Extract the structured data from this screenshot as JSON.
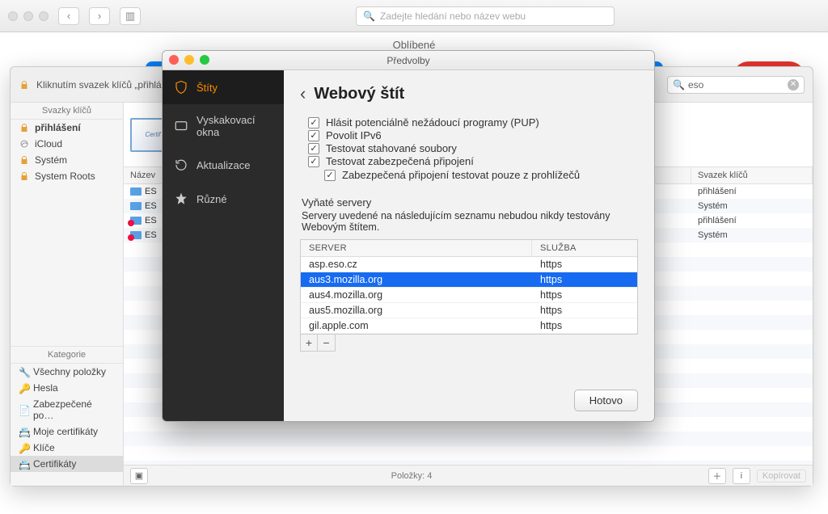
{
  "browser": {
    "search_placeholder": "Zadejte hledání nebo název webu",
    "favorites_label": "Oblíbené"
  },
  "keychain": {
    "title_prefix": "Kliknutím svazek klíčů „přihláš",
    "search_value": "eso",
    "side_header": "Svazky klíčů",
    "chains": [
      {
        "label": "přihlášení",
        "bold": true
      },
      {
        "label": "iCloud"
      },
      {
        "label": "Systém"
      },
      {
        "label": "System Roots"
      }
    ],
    "categories_header": "Kategorie",
    "categories": [
      "Všechny položky",
      "Hesla",
      "Zabezpečené po…",
      "Moje certifikáty",
      "Klíče",
      "Certifikáty"
    ],
    "selected_category_index": 5,
    "table_headers": {
      "name": "Název",
      "chain": "Svazek klíčů"
    },
    "rows": [
      {
        "name": "ES",
        "chain": "přihlášení",
        "err": false
      },
      {
        "name": "ES",
        "chain": "Systém",
        "err": false
      },
      {
        "name": "ES",
        "chain": "přihlášení",
        "err": true
      },
      {
        "name": "ES",
        "chain": "Systém",
        "err": true
      }
    ],
    "footer_count": "Položky: 4",
    "copy_label": "Kopírovat"
  },
  "prefs": {
    "window_title": "Předvolby",
    "sidebar": [
      {
        "key": "shields",
        "label": "Štíty"
      },
      {
        "key": "popups",
        "label": "Vyskakovací okna"
      },
      {
        "key": "updates",
        "label": "Aktualizace"
      },
      {
        "key": "misc",
        "label": "Různé"
      }
    ],
    "active_sidebar_index": 0,
    "page_title": "Webový štít",
    "checks": [
      {
        "label": "Hlásit potenciálně nežádoucí programy (PUP)",
        "checked": true
      },
      {
        "label": "Povolit IPv6",
        "checked": true
      },
      {
        "label": "Testovat stahované soubory",
        "checked": true
      },
      {
        "label": "Testovat zabezpečená připojení",
        "checked": true
      }
    ],
    "sub_check": {
      "label": "Zabezpečená připojení testovat pouze z prohlížečů",
      "checked": true
    },
    "exempt_header": "Vyňaté servery",
    "exempt_desc": "Servery uvedené na následujícím seznamu nebudou nikdy testovány Webovým štítem.",
    "server_table": {
      "headers": {
        "server": "SERVER",
        "service": "SLUŽBA"
      },
      "rows": [
        {
          "server": "asp.eso.cz",
          "service": "https"
        },
        {
          "server": "aus3.mozilla.org",
          "service": "https"
        },
        {
          "server": "aus4.mozilla.org",
          "service": "https"
        },
        {
          "server": "aus5.mozilla.org",
          "service": "https"
        },
        {
          "server": "gil.apple.com",
          "service": "https"
        }
      ],
      "selected_index": 1
    },
    "done_label": "Hotovo"
  }
}
